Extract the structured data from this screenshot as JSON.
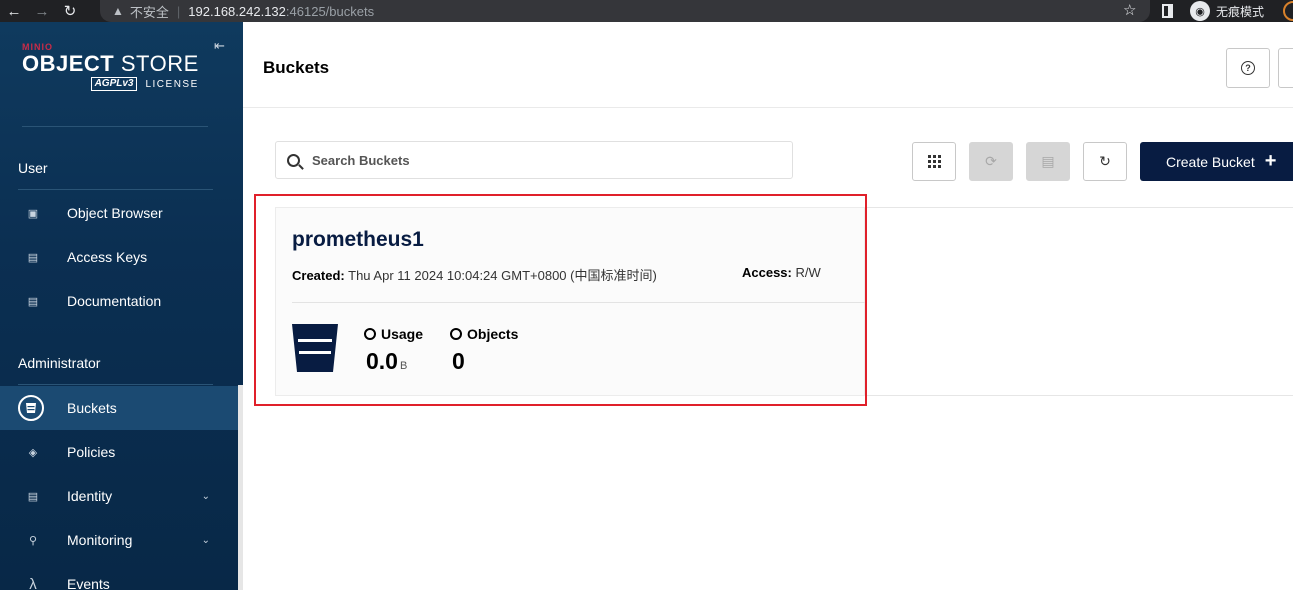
{
  "browser": {
    "insecure_label": "不安全",
    "url_host": "192.168.242.132",
    "url_path": ":46125/buckets",
    "incognito_label": "无痕模式"
  },
  "sidebar": {
    "brand_small": "MINIO",
    "brand_main_bold": "OBJECT",
    "brand_main": " STORE",
    "agpl": "AGPLv3",
    "license": "LICENSE",
    "sections": [
      {
        "title": "User",
        "items": [
          {
            "label": "Object Browser",
            "icon": "object-browser-icon"
          },
          {
            "label": "Access Keys",
            "icon": "access-keys-icon"
          },
          {
            "label": "Documentation",
            "icon": "documentation-icon"
          }
        ]
      },
      {
        "title": "Administrator",
        "items": [
          {
            "label": "Buckets",
            "icon": "bucket-icon",
            "active": true
          },
          {
            "label": "Policies",
            "icon": "shield-icon"
          },
          {
            "label": "Identity",
            "icon": "identity-icon",
            "expandable": true
          },
          {
            "label": "Monitoring",
            "icon": "monitoring-icon",
            "expandable": true
          },
          {
            "label": "Events",
            "icon": "lambda-icon"
          }
        ]
      }
    ]
  },
  "header": {
    "title": "Buckets",
    "help_icon": "?"
  },
  "toolbar": {
    "search_placeholder": "Search Buckets",
    "create_label": "Create Bucket",
    "create_icon": "+"
  },
  "buckets": [
    {
      "name": "prometheus1",
      "created_label": "Created:",
      "created_value": "Thu Apr 11 2024 10:04:24 GMT+0800 (中国标准时间)",
      "access_label": "Access:",
      "access_value": "R/W",
      "usage_label": "Usage",
      "usage_value": "0.0",
      "usage_unit": "B",
      "objects_label": "Objects",
      "objects_value": "0"
    }
  ],
  "colors": {
    "sidebar_bg": "#0b2f52",
    "primary": "#081c42",
    "highlight": "#e0202a",
    "brand_red": "#c72c48"
  }
}
